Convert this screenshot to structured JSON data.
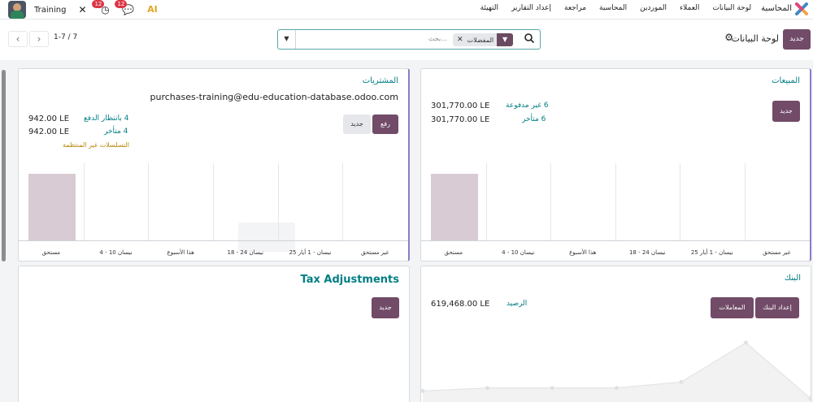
{
  "navbar": {
    "brand": "المحاسبة",
    "menu": [
      "لوحة البيانات",
      "العملاء",
      "الموردين",
      "المحاسبة",
      "مراجعة",
      "إعداد التقارير",
      "التهيئة"
    ],
    "company": "Training",
    "activity_count": "12",
    "messages_count": "12",
    "ai_label": "AI"
  },
  "control": {
    "pager_value": "1-7 / 7",
    "search_placeholder": "بحث...",
    "facet_label": "المفضلات",
    "title": "لوحة البيانات",
    "new_button": "جديد"
  },
  "purchases": {
    "title": "المشتريات",
    "email": "purchases-training@edu-education-database.odoo.com",
    "upload_button": "رفع",
    "new_button": "جديد",
    "stat1_label": "4 بانتظار الدفع",
    "stat1_value": "942.00 LE",
    "stat2_label": "4 متأخر",
    "stat2_value": "942.00 LE",
    "warning": "التسلسلات غير المنتظمة",
    "chart_labels": [
      "مستحق",
      "4 - 10 نيسان",
      "هذا الأسبوع",
      "18 - 24 نيسان",
      "25 نيسان - 1 أيار",
      "غير مستحق"
    ]
  },
  "sales": {
    "title": "المبيعات",
    "new_button": "جديد",
    "stat1_label": "6 غير مدفوعة",
    "stat1_value": "301,770.00 LE",
    "stat2_label": "6 متأخر",
    "stat2_value": "301,770.00 LE",
    "chart_labels": [
      "مستحق",
      "4 - 10 نيسان",
      "هذا الأسبوع",
      "18 - 24 نيسان",
      "25 نيسان - 1 أيار",
      "غير مستحق"
    ]
  },
  "tax": {
    "title": "Tax Adjustments",
    "new_button": "جديد"
  },
  "bank": {
    "title": "البنك",
    "balance_label": "الرصيد",
    "balance_value": "619,468.00 LE",
    "setup_button": "إعداد البنك",
    "transactions_button": "المعاملات"
  },
  "chart_data": [
    {
      "type": "bar",
      "categories": [
        "مستحق",
        "4 - 10 نيسان",
        "هذا الأسبوع",
        "18 - 24 نيسان",
        "25 نيسان - 1 أيار",
        "غير مستحق"
      ],
      "values": [
        942,
        0,
        0,
        0,
        0,
        0
      ]
    },
    {
      "type": "bar",
      "categories": [
        "مستحق",
        "4 - 10 نيسان",
        "هذا الأسبوع",
        "18 - 24 نيسان",
        "25 نيسان - 1 أيار",
        "غير مستحق"
      ],
      "values": [
        301770,
        0,
        0,
        0,
        0,
        0
      ]
    },
    {
      "type": "line",
      "values": [
        1,
        1.2,
        1.2,
        1.2,
        1.6,
        4.2,
        0.5
      ]
    }
  ]
}
